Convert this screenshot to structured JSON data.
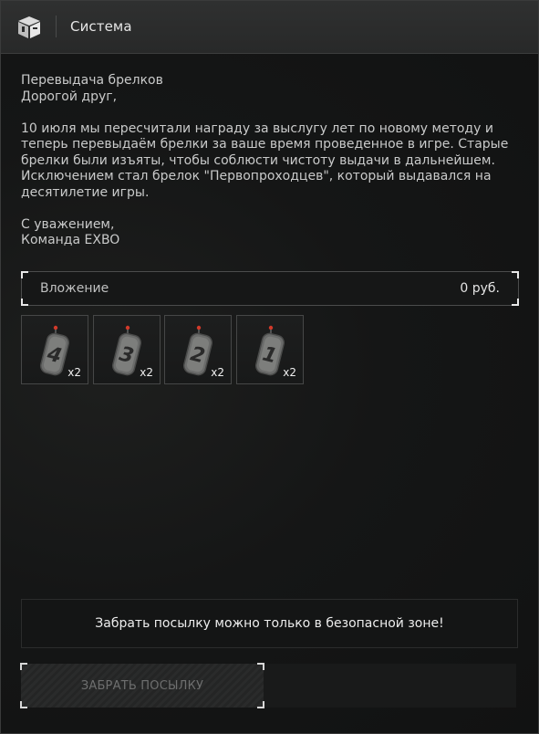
{
  "header": {
    "icon": "package-icon",
    "title": "Система"
  },
  "message": {
    "subject": "Перевыдача брелков",
    "greeting": "Дорогой друг,",
    "body_line_1": "10 июля мы пересчитали награду за выслугу лет по новому методу и",
    "body_line_2": "теперь перевыдаём брелки за ваше время проведенное в игре. Старые",
    "body_line_3": "брелки были изъяты, чтобы соблюсти чистоту выдачи в дальнейшем.",
    "body_line_4": "Исключением стал брелок \"Первопроходцев\", который выдавался на",
    "body_line_5": "десятилетие игры.",
    "signoff": "С уважением,",
    "signature": "Команда EXBO"
  },
  "attachment": {
    "label": "Вложение",
    "value": "0 руб."
  },
  "items": [
    {
      "icon": "keychain-4-icon",
      "number": "4",
      "qty": "x2"
    },
    {
      "icon": "keychain-3-icon",
      "number": "3",
      "qty": "x2"
    },
    {
      "icon": "keychain-2-icon",
      "number": "2",
      "qty": "x2"
    },
    {
      "icon": "keychain-1-icon",
      "number": "1",
      "qty": "x2"
    }
  ],
  "notice": {
    "text": "Забрать посылку можно только в безопасной зоне!"
  },
  "actions": {
    "take_label": "ЗАБРАТЬ ПОСЫЛКУ"
  },
  "colors": {
    "accent_marker": "#d23a2a",
    "text_primary": "#e6e6e6",
    "text_secondary": "#c9caca",
    "button_disabled_text": "#6e6f6f"
  }
}
